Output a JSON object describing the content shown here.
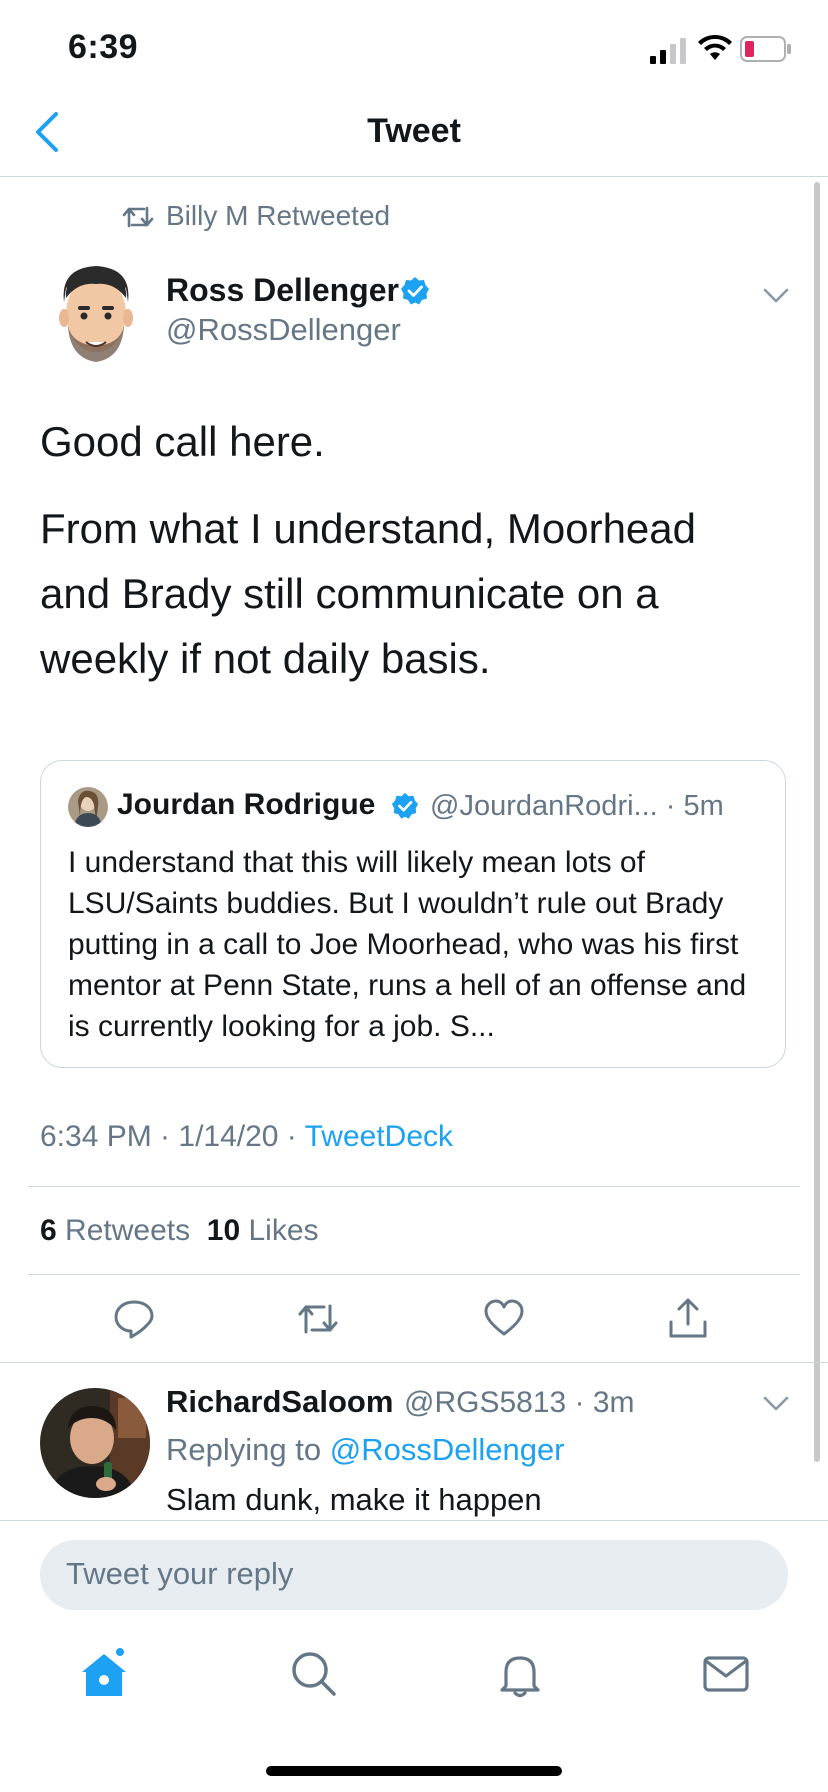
{
  "status_bar": {
    "time": "6:39"
  },
  "nav": {
    "title": "Tweet"
  },
  "retweet_header": {
    "text": "Billy M Retweeted"
  },
  "tweet": {
    "author_name": "Ross Dellenger",
    "author_handle": "@RossDellenger",
    "text_line1": "Good call here.",
    "text_paragraph2": "From what I understand, Moorhead and Brady still communicate on a weekly if not daily basis.",
    "quoted": {
      "name": "Jourdan Rodrigue",
      "handle": "@JourdanRodri...",
      "time": "· 5m",
      "text": "I understand that this will likely mean lots of LSU/Saints buddies. But I wouldn’t rule out Brady putting in a call to Joe Moorhead, who was his first mentor at Penn State, runs a hell of an offense and is currently looking for a job. S..."
    },
    "timestamp": "6:34 PM · 1/14/20 · ",
    "source": "TweetDeck",
    "retweets_count": "6",
    "retweets_label": "Retweets",
    "likes_count": "10",
    "likes_label": "Likes"
  },
  "reply": {
    "name": "RichardSaloom",
    "handle": "@RGS5813 · 3m",
    "replying_prefix": "Replying to ",
    "replying_to": "@RossDellenger",
    "text": "Slam dunk, make it happen"
  },
  "compose": {
    "placeholder": "Tweet your reply"
  },
  "icons": {
    "back": "chevron-left-icon",
    "retweet": "retweet-icon",
    "verified": "verified-badge-icon",
    "reply": "reply-icon",
    "like": "heart-icon",
    "share": "share-icon",
    "home": "home-icon",
    "search": "search-icon",
    "notifications": "bell-icon",
    "messages": "mail-icon"
  },
  "colors": {
    "accent": "#1da1f2",
    "secondary_text": "#657786",
    "battery_low": "#e0245e"
  }
}
